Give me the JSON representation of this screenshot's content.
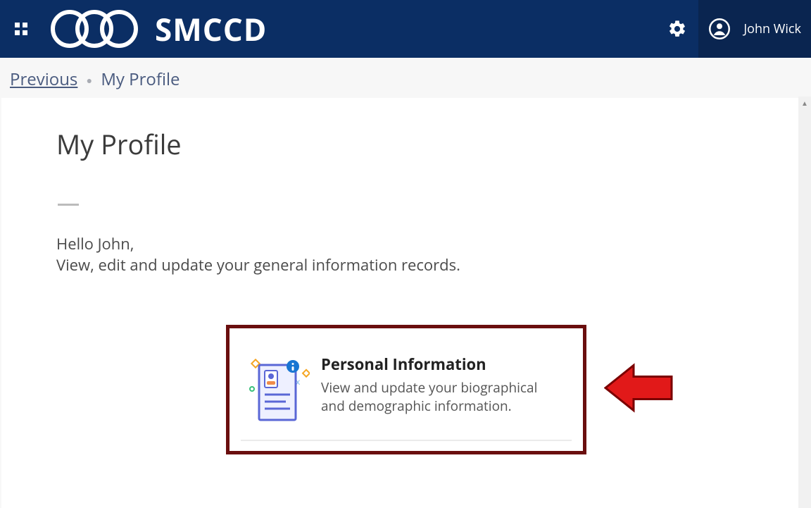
{
  "header": {
    "brand": "SMCCD",
    "username": "John Wick"
  },
  "breadcrumb": {
    "prev": "Previous",
    "current": "My Profile"
  },
  "page": {
    "title": "My Profile",
    "greeting_line1": "Hello John,",
    "greeting_line2": "View, edit and update your general information records."
  },
  "card": {
    "title": "Personal Information",
    "desc": "View and update your biographical and demographic information."
  }
}
